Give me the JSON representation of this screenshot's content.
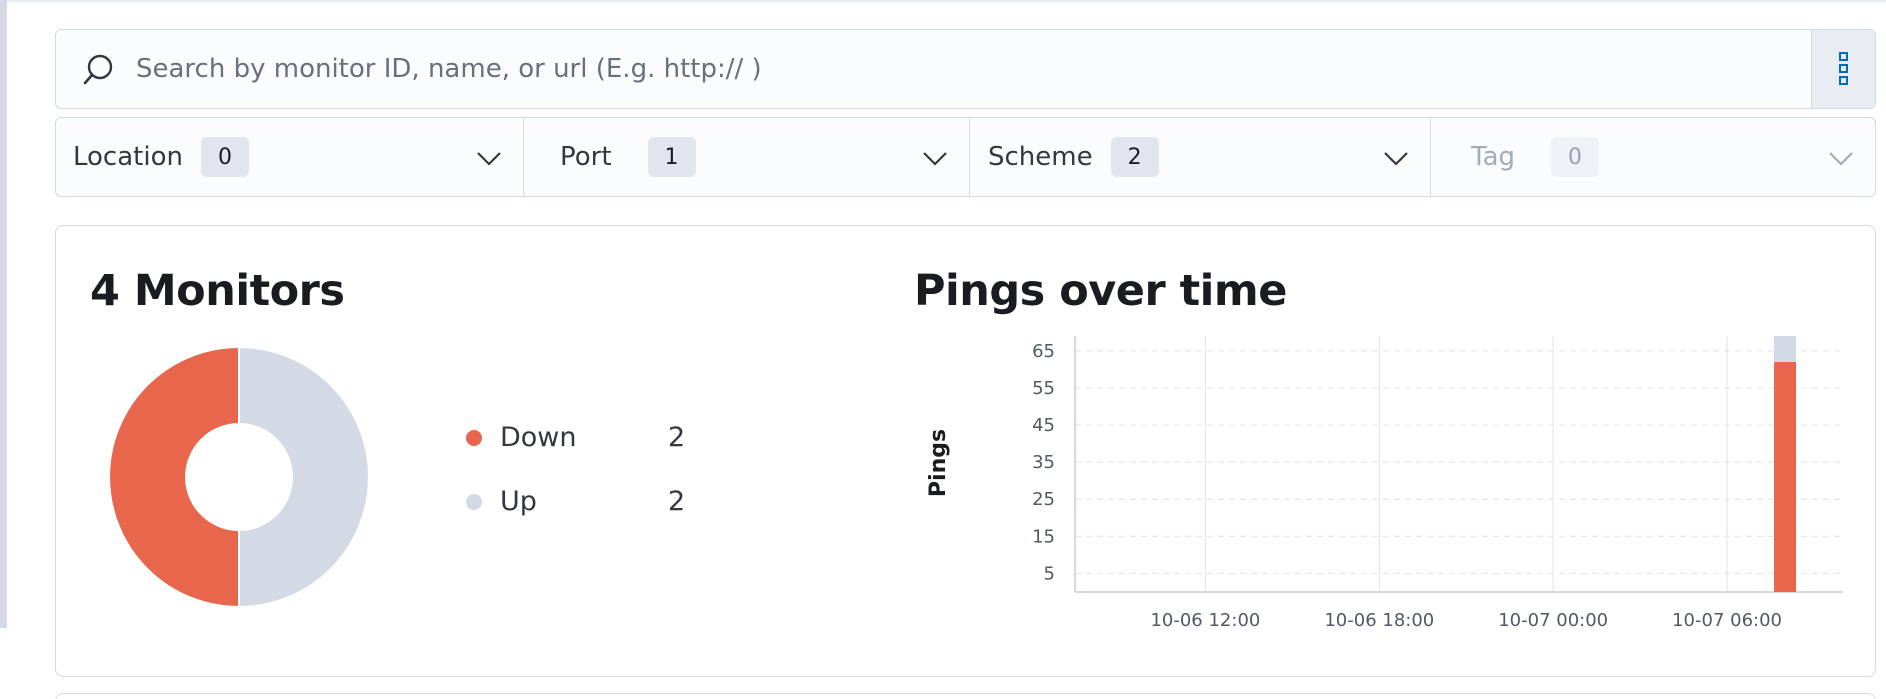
{
  "search": {
    "placeholder": "Search by monitor ID, name, or url (E.g. http:// )",
    "icon": "search-icon",
    "options_icon": "kebab-icon"
  },
  "filters": [
    {
      "label": "Location",
      "count": "0",
      "disabled": false
    },
    {
      "label": "Port",
      "count": "1",
      "disabled": false
    },
    {
      "label": "Scheme",
      "count": "2",
      "disabled": false
    },
    {
      "label": "Tag",
      "count": "0",
      "disabled": true
    }
  ],
  "status_summary": {
    "title": "4 Monitors",
    "legend": [
      {
        "label": "Down",
        "value": "2",
        "color": "#e7664c"
      },
      {
        "label": "Up",
        "value": "2",
        "color": "#d3dae6"
      }
    ]
  },
  "pings": {
    "title": "Pings over time"
  },
  "colors": {
    "down": "#e7664c",
    "up": "#d3dae6",
    "accent": "#006bb8"
  },
  "chart_data": [
    {
      "type": "pie",
      "donut": true,
      "categories": [
        "Down",
        "Up"
      ],
      "values": [
        2,
        2
      ],
      "colors": [
        "#e7664c",
        "#d3dae6"
      ],
      "title": "4 Monitors"
    },
    {
      "type": "bar",
      "stacked": true,
      "title": "Pings over time",
      "ylabel": "Pings",
      "xlabel": "",
      "x_ticks": [
        "10-06 12:00",
        "10-06 18:00",
        "10-07 00:00",
        "10-07 06:00"
      ],
      "y_ticks": [
        5,
        15,
        25,
        35,
        45,
        55,
        65
      ],
      "ylim": [
        0,
        69
      ],
      "x_range": [
        "10-06 07:30",
        "10-07 10:00"
      ],
      "categories": [
        "10-07 08:00"
      ],
      "series": [
        {
          "name": "Down",
          "values": [
            62
          ],
          "color": "#e7664c"
        },
        {
          "name": "Up",
          "values": [
            7
          ],
          "color": "#d3dae6"
        }
      ],
      "grid": true
    }
  ]
}
